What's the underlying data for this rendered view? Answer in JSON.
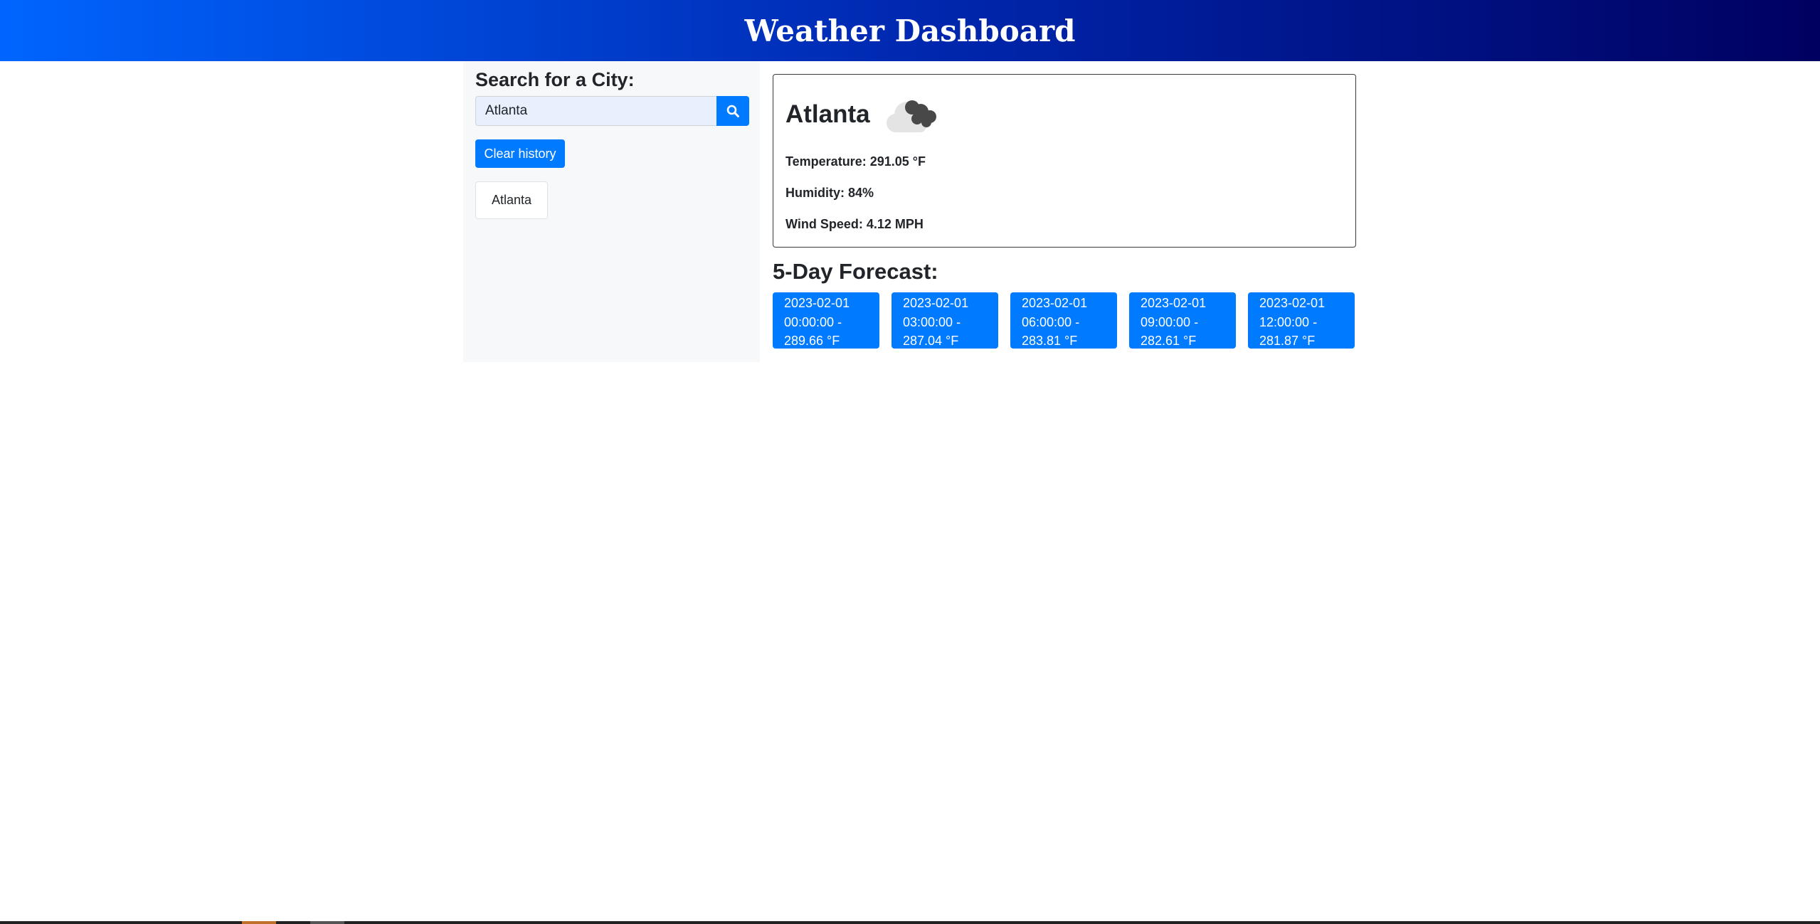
{
  "header": {
    "title": "Weather Dashboard"
  },
  "search": {
    "heading": "Search for a City:",
    "value": "Atlanta",
    "placeholder": "",
    "button_icon": "search-icon"
  },
  "clear_button": {
    "label": "Clear history"
  },
  "history": [
    "Atlanta"
  ],
  "current": {
    "city": "Atlanta",
    "icon": "broken-clouds-icon",
    "temperature": "Temperature: 291.05 °F",
    "humidity": "Humidity: 84%",
    "wind": "Wind Speed: 4.12 MPH"
  },
  "forecast": {
    "title": "5-Day Forecast:",
    "items": [
      {
        "date": "2023-02-01",
        "time": "00:00:00 -",
        "temp": "289.66 °F"
      },
      {
        "date": "2023-02-01",
        "time": "03:00:00 -",
        "temp": "287.04 °F"
      },
      {
        "date": "2023-02-01",
        "time": "06:00:00 -",
        "temp": "283.81 °F"
      },
      {
        "date": "2023-02-01",
        "time": "09:00:00 -",
        "temp": "282.61 °F"
      },
      {
        "date": "2023-02-01",
        "time": "12:00:00 -",
        "temp": "281.87 °F"
      }
    ]
  },
  "colors": {
    "primary": "#007bff",
    "header_gradient_start": "#0065ff",
    "header_gradient_end": "#000060",
    "sidebar_bg": "#f7f8fa"
  }
}
